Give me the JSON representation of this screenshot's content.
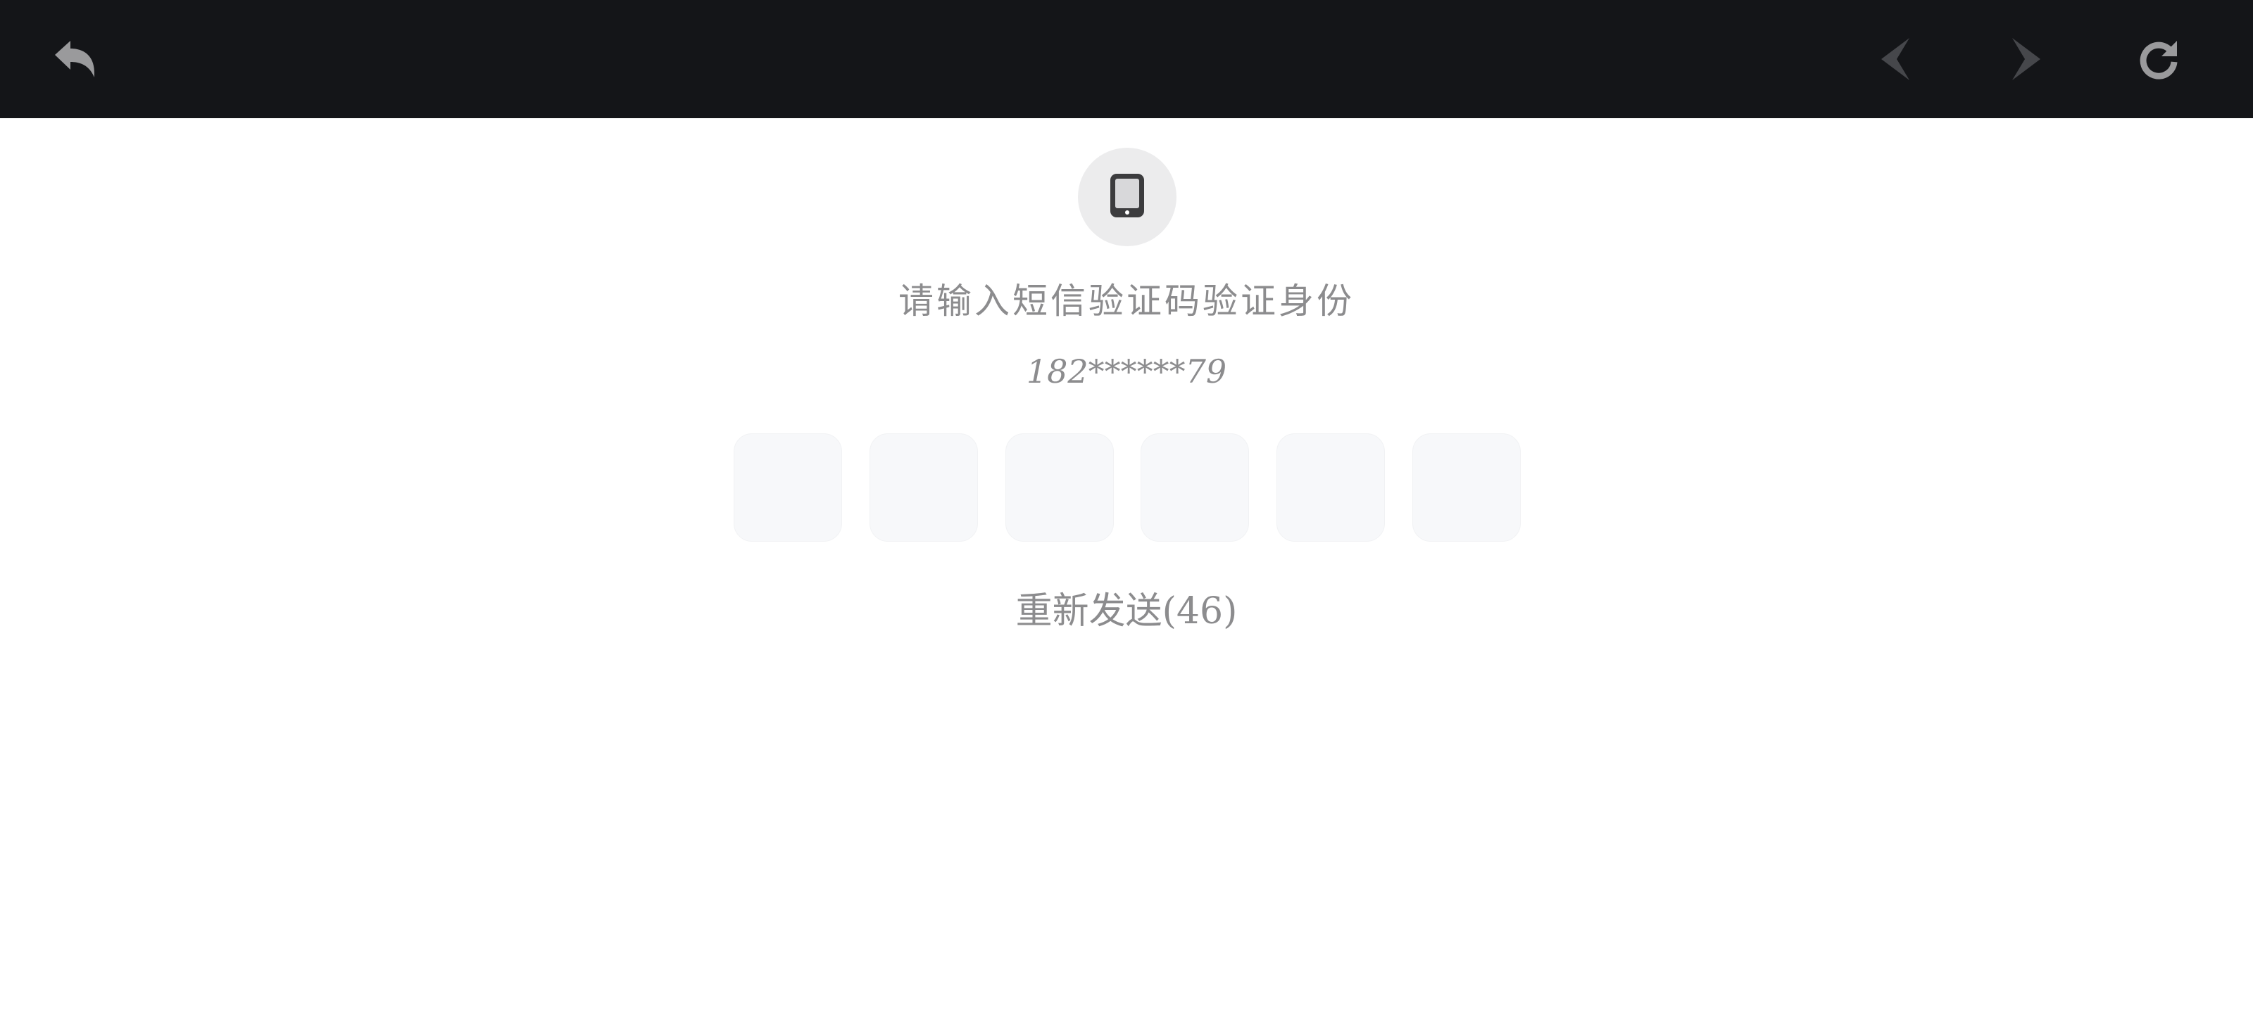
{
  "toolbar": {
    "icons": {
      "back": "back-arrow-icon",
      "prev": "prev-icon",
      "next": "next-icon",
      "refresh": "refresh-icon"
    },
    "background": "#141518",
    "icon_color_active": "#9a9a9c",
    "icon_color_disabled": "#46474b"
  },
  "verification": {
    "icon": "smartphone-icon",
    "title": "请输入短信验证码验证身份",
    "phone_masked": "182******79",
    "code_boxes": [
      "",
      "",
      "",
      "",
      "",
      ""
    ],
    "resend_label": "重新发送(46)",
    "text_color": "#8c8c8e"
  }
}
